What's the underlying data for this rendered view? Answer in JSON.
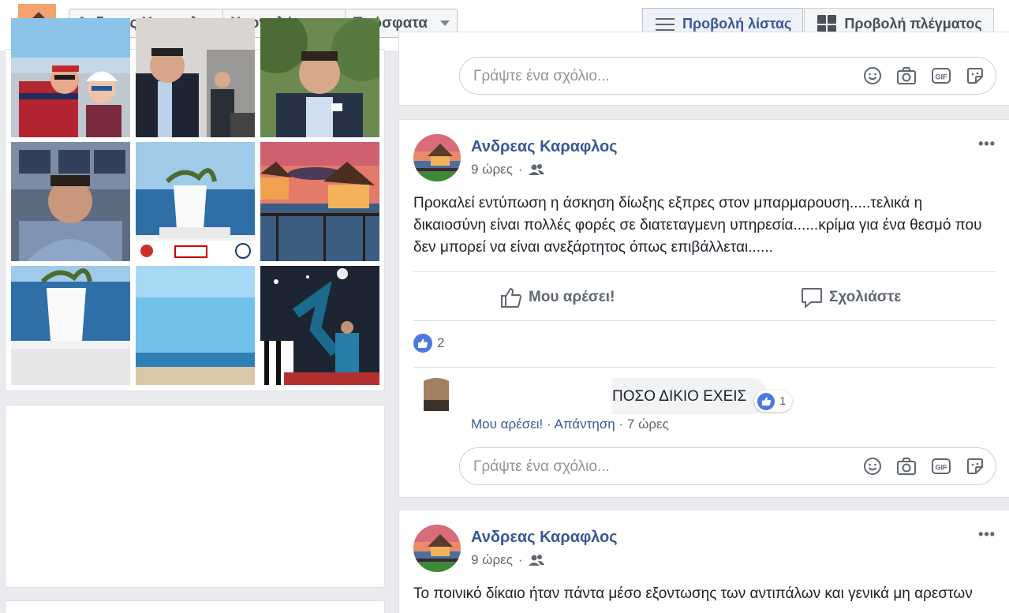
{
  "header": {
    "breadcrumbs": [
      {
        "label": "Ανδρεας Καραφλος",
        "dropdown": false
      },
      {
        "label": "Χρονολόγιο",
        "dropdown": true
      },
      {
        "label": "Πρόσφατα",
        "dropdown": true
      }
    ],
    "view_buttons": [
      {
        "label": "Προβολή λίστας",
        "icon": "list-icon",
        "active": true
      },
      {
        "label": "Προβολή πλέγματος",
        "icon": "grid-icon",
        "active": false
      }
    ]
  },
  "photos": {
    "items": [
      {
        "subject": "selfie-couple-boat"
      },
      {
        "subject": "man-in-suit-conference"
      },
      {
        "subject": "man-in-suit-outdoors"
      },
      {
        "subject": "man-in-hoodie-selfie"
      },
      {
        "subject": "white-vase-sea-worldcup"
      },
      {
        "subject": "sunset-overwater-villas"
      },
      {
        "subject": "white-vase-sea"
      },
      {
        "subject": "beach-blue-sky"
      },
      {
        "subject": "football-bicycle-kick"
      }
    ]
  },
  "top_comment_box": {
    "placeholder": "Γράψτε ένα σχόλιο...",
    "icons": [
      "smiley-icon",
      "camera-icon",
      "gif-icon",
      "sticker-icon"
    ]
  },
  "posts": [
    {
      "author": "Ανδρεας Καραφλος",
      "time": "9 ώρες",
      "audience_icon": "friends-icon",
      "text": "Προκαλεί εντύπωση η άσκηση δίωξης εξπρες στον μπαρμαρουση.....τελικά η δικαιοσύνη είναι πολλές φορές σε διατεταγμενη υπηρεσία......κρίμα για ένα θεσμό που δεν μπορεί να είναι ανεξάρτητος όπως επιβάλλεται......",
      "like_label": "Μου αρέσει!",
      "comment_label": "Σχολιάστε",
      "like_count": "2",
      "comment": {
        "text": "ΠΟΣΟ ΔΙΚΙΟ ΕΧΕΙΣ",
        "likes": "1",
        "like_link": "Μου αρέσει!",
        "reply_link": "Απάντηση",
        "time": "7 ώρες"
      },
      "comment_placeholder": "Γράψτε ένα σχόλιο..."
    },
    {
      "author": "Ανδρεας Καραφλος",
      "time": "9 ώρες",
      "audience_icon": "friends-icon",
      "text": "Το ποινικό δίκαιο ήταν πάντα μέσο εξοντωσης των αντιπάλων και γενικά μη αρεστων"
    }
  ],
  "colors": {
    "link_blue": "#365899",
    "like_blue": "#4a7ae0",
    "page_bg": "#e9ebee"
  }
}
